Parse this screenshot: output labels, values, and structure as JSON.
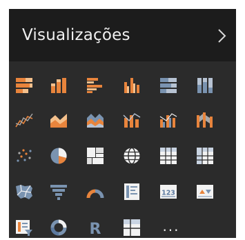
{
  "pane": {
    "title": "Visualizações",
    "collapse_icon": "chevron-right-icon"
  },
  "colors": {
    "background": "#2b2b2b",
    "header": "#1c1c1c",
    "orange": "#e8843c",
    "blue": "#7a93b0",
    "gray": "#a9a9a9",
    "white": "#f2f2f2"
  },
  "visuals": [
    {
      "name": "stacked-bar-chart-icon"
    },
    {
      "name": "stacked-column-chart-icon"
    },
    {
      "name": "clustered-bar-chart-icon"
    },
    {
      "name": "clustered-column-chart-icon"
    },
    {
      "name": "100-stacked-bar-chart-icon"
    },
    {
      "name": "100-stacked-column-chart-icon"
    },
    {
      "name": "line-chart-icon"
    },
    {
      "name": "area-chart-icon"
    },
    {
      "name": "stacked-area-chart-icon"
    },
    {
      "name": "line-and-stacked-column-chart-icon"
    },
    {
      "name": "line-and-clustered-column-chart-icon"
    },
    {
      "name": "ribbon-chart-icon"
    },
    {
      "name": "scatter-chart-icon"
    },
    {
      "name": "pie-chart-icon"
    },
    {
      "name": "treemap-icon"
    },
    {
      "name": "map-icon"
    },
    {
      "name": "table-icon"
    },
    {
      "name": "matrix-icon"
    },
    {
      "name": "filled-map-icon"
    },
    {
      "name": "funnel-icon"
    },
    {
      "name": "gauge-icon"
    },
    {
      "name": "multi-row-card-icon"
    },
    {
      "name": "card-icon",
      "label": "123"
    },
    {
      "name": "kpi-icon"
    },
    {
      "name": "slicer-icon"
    },
    {
      "name": "donut-chart-icon"
    },
    {
      "name": "r-script-visual-icon",
      "label": "R"
    },
    {
      "name": "custom-table-visual-icon"
    },
    {
      "name": "more-options-icon",
      "label": "..."
    }
  ]
}
